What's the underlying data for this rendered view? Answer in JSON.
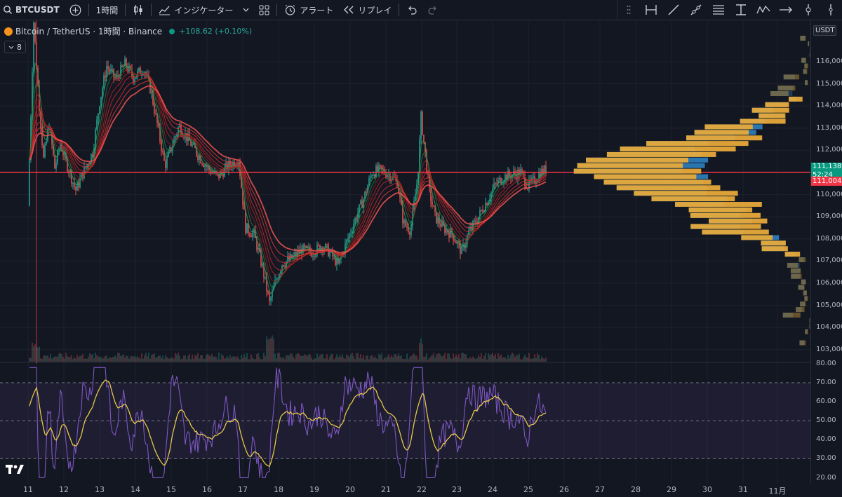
{
  "toolbar": {
    "symbol": "BTCUSDT",
    "interval": "1時間",
    "indicators": "インジケーター",
    "alert": "アラート",
    "replay": "リプレイ"
  },
  "legend": {
    "title": "Bitcoin / TetherUS · 1時間 · Binance",
    "change": "+108.62 (+0.10%)",
    "collapsed_count": "8"
  },
  "price_axis": {
    "currency": "USDT",
    "ticks": [
      "116,000.00",
      "115,000.00",
      "114,000.00",
      "113,000.00",
      "112,000.00",
      "110,000.00",
      "109,000.00",
      "108,000.00",
      "107,000.00",
      "106,000.00",
      "105,000.00",
      "104,000.00",
      "103,000.00"
    ],
    "last_price": "111,138.35",
    "countdown": "52:24",
    "line_price": "111,004.50"
  },
  "rsi_axis": {
    "ticks": [
      "80.00",
      "70.00",
      "60.00",
      "50.00",
      "40.00",
      "30.00",
      "20.00"
    ]
  },
  "time_axis": {
    "labels": [
      "11",
      "12",
      "13",
      "14",
      "15",
      "16",
      "17",
      "18",
      "19",
      "20",
      "21",
      "22",
      "23",
      "24",
      "25",
      "26",
      "27",
      "28",
      "29",
      "30",
      "31",
      "11月"
    ]
  },
  "colors": {
    "up": "#26a69a",
    "down": "#ef5350",
    "rsi": "#7e57c2",
    "rsi_ma": "#e6c84a",
    "hline": "#f23645",
    "vp_up": "#e6a93a",
    "vp_down": "#2f7fc1"
  },
  "icons": [
    "plus-circle-icon",
    "candles-icon",
    "indicators-icon",
    "layout-icon",
    "alarm-icon",
    "replay-icon",
    "undo-icon",
    "redo-icon"
  ]
}
